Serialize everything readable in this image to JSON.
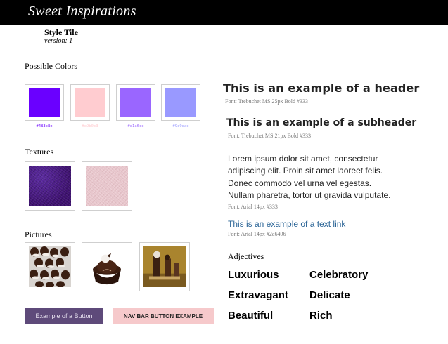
{
  "brand": "Sweet Inspirations",
  "tile": {
    "title": "Style Tile",
    "version": "version: 1"
  },
  "sections": {
    "colors": "Possible Colors",
    "textures": "Textures",
    "pictures": "Pictures"
  },
  "colors": [
    {
      "hex": "#6a00ff",
      "code": "#483c8e"
    },
    {
      "hex": "#ffccd0",
      "code": "#e9b0c3"
    },
    {
      "hex": "#9a66ff",
      "code": "#e1a6ce"
    },
    {
      "hex": "#9999ff",
      "code": "#9c9eae"
    }
  ],
  "textures": [
    "purple-fabric-texture",
    "pink-paper-texture"
  ],
  "pictures": [
    "chocolates-picture",
    "truffle-cupcake-picture",
    "chocolate-figurines-picture"
  ],
  "buttons": {
    "example": "Example of a Button",
    "navbar": "NAV BAR BUTTON EXAMPLE"
  },
  "typography": {
    "header": "This is an example of a header",
    "header_spec": "Font: Trebuchet MS 25px Bold #333",
    "subheader": "This is an example of a subheader",
    "subheader_spec": "Font: Trebuchet MS 21px Bold #333",
    "lorem_lines": [
      "Lorem ipsum dolor sit amet, consectetur",
      "adipiscing elit. Proin sit amet laoreet felis.",
      "Donec commodo vel urna vel egestas.",
      "Nullam pharetra, tortor ut gravida vulputate."
    ],
    "body_spec": "Font: Arial 14px #333",
    "link": "This is an example of a text link",
    "link_spec": "Font: Arial 14px #2a6496"
  },
  "adjectives": {
    "title": "Adjectives",
    "left": [
      "Luxurious",
      "Extravagant",
      "Beautiful"
    ],
    "right": [
      "Celebratory",
      "Delicate",
      "Rich"
    ]
  }
}
